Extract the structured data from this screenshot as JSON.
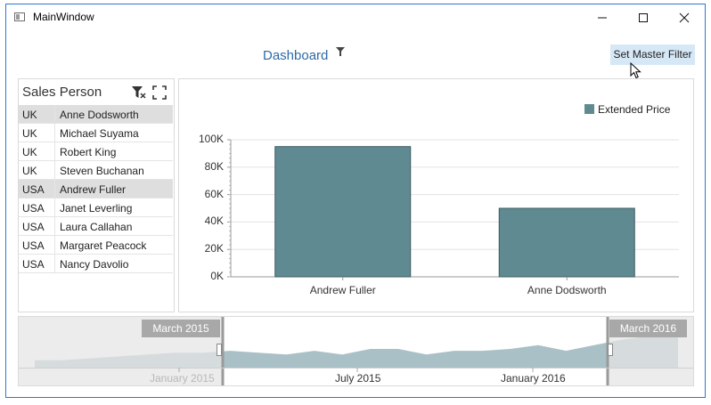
{
  "window": {
    "title": "MainWindow"
  },
  "dashboard": {
    "title": "Dashboard",
    "master_filter_label": "Set Master Filter"
  },
  "sales_person": {
    "title": "Sales Person",
    "rows": [
      {
        "country": "UK",
        "name": "Anne Dodsworth",
        "selected": true
      },
      {
        "country": "UK",
        "name": "Michael Suyama",
        "selected": false
      },
      {
        "country": "UK",
        "name": "Robert King",
        "selected": false
      },
      {
        "country": "UK",
        "name": "Steven Buchanan",
        "selected": false
      },
      {
        "country": "USA",
        "name": "Andrew Fuller",
        "selected": true
      },
      {
        "country": "USA",
        "name": "Janet Leverling",
        "selected": false
      },
      {
        "country": "USA",
        "name": "Laura Callahan",
        "selected": false
      },
      {
        "country": "USA",
        "name": "Margaret Peacock",
        "selected": false
      },
      {
        "country": "USA",
        "name": "Nancy Davolio",
        "selected": false
      }
    ]
  },
  "chart_data": {
    "type": "bar",
    "categories": [
      "Andrew Fuller",
      "Anne Dodsworth"
    ],
    "series": [
      {
        "name": "Extended Price",
        "values": [
          95000,
          50000
        ]
      }
    ],
    "yticks": [
      "0K",
      "20K",
      "40K",
      "60K",
      "80K",
      "100K"
    ],
    "ylim": [
      0,
      100000
    ],
    "legend": "top-right",
    "colors": {
      "bar": "#5f8a92",
      "bar_border": "#3c5d63"
    }
  },
  "range_filter": {
    "selected_start": "March 2015",
    "selected_end": "March 2016",
    "axis_labels": [
      "January 2015",
      "July 2015",
      "January 2016"
    ],
    "area_values": [
      4,
      4,
      5,
      6,
      7,
      8,
      8,
      9,
      8,
      7,
      9,
      7,
      10,
      10,
      7,
      9,
      9,
      10,
      12,
      9,
      12,
      15,
      17,
      17
    ]
  }
}
